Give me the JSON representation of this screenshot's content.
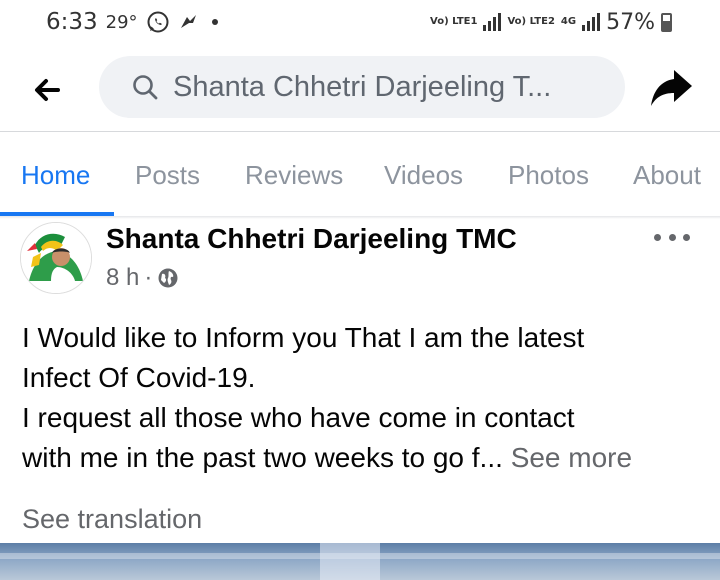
{
  "status_bar": {
    "time": "6:33",
    "temperature": "29°",
    "sim1_label": "Vo) LTE1",
    "sim2_label": "Vo) LTE2",
    "network": "4G",
    "battery": "57%",
    "battery_level": 0.57,
    "icons": [
      "whatsapp-icon",
      "bird-icon",
      "dot-icon",
      "signal-icon",
      "battery-icon"
    ]
  },
  "top_bar": {
    "search_text": "Shanta Chhetri Darjeeling T...",
    "icons": [
      "back-arrow-icon",
      "search-icon",
      "share-icon"
    ]
  },
  "tabs": [
    {
      "label": "Home",
      "active": true
    },
    {
      "label": "Posts",
      "active": false
    },
    {
      "label": "Reviews",
      "active": false
    },
    {
      "label": "Videos",
      "active": false
    },
    {
      "label": "Photos",
      "active": false
    },
    {
      "label": "About",
      "active": false
    }
  ],
  "post": {
    "author": "Shanta Chhetri Darjeeling TMC",
    "time": "8 h",
    "separator": "·",
    "lines": [
      "I Would like to Inform you That I am the latest",
      "Infect Of Covid-19.",
      "I request all those who have come in contact",
      "with me in the past two weeks to go f..."
    ],
    "see_more": "See more",
    "see_translation": "See translation"
  },
  "colors": {
    "accent": "#1877f2",
    "tab_inactive": "#8d949e",
    "secondary_text": "#65676b",
    "search_bg": "#f0f2f5"
  }
}
